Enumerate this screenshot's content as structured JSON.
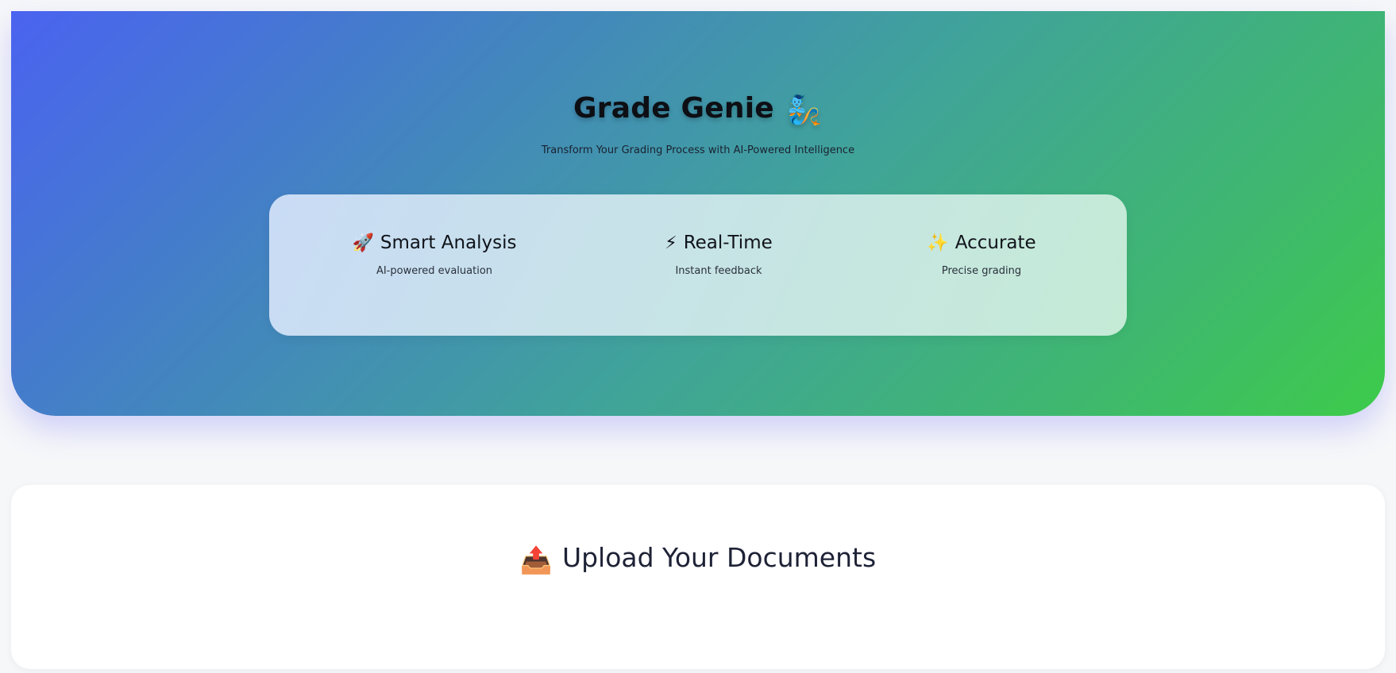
{
  "hero": {
    "title": "Grade Genie",
    "title_icon": "🧞",
    "subtitle": "Transform Your Grading Process with AI-Powered Intelligence",
    "gradient_colors": [
      "#4a63f0",
      "#3dcb4a"
    ]
  },
  "features": [
    {
      "icon": "🚀",
      "icon_name": "rocket-icon",
      "title": "Smart Analysis",
      "description": "AI-powered evaluation"
    },
    {
      "icon": "⚡",
      "icon_name": "lightning-icon",
      "title": "Real-Time",
      "description": "Instant feedback"
    },
    {
      "icon": "✨",
      "icon_name": "sparkles-icon",
      "title": "Accurate",
      "description": "Precise grading"
    }
  ],
  "upload": {
    "icon": "📤",
    "icon_name": "outbox-tray-icon",
    "title": "Upload Your Documents"
  }
}
